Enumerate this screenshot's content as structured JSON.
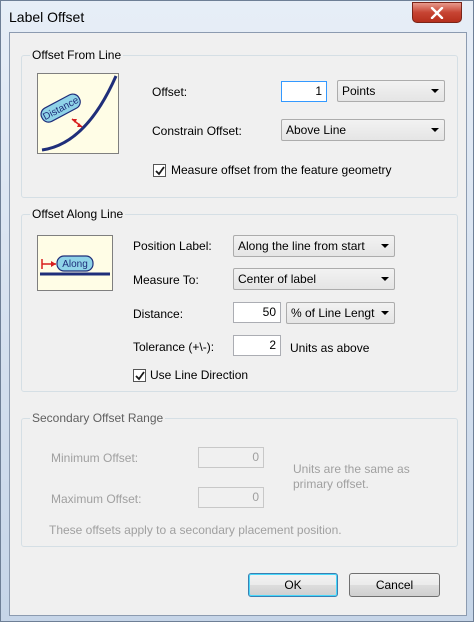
{
  "window": {
    "title": "Label Offset"
  },
  "offset_from_line": {
    "group_title": "Offset From Line",
    "preview_label": "Distance",
    "offset_label": "Offset:",
    "offset_value": "1",
    "offset_units": "Points",
    "constrain_label": "Constrain Offset:",
    "constrain_value": "Above Line",
    "measure_geometry_label": "Measure offset from the feature geometry",
    "measure_geometry_checked": true
  },
  "offset_along_line": {
    "group_title": "Offset Along Line",
    "preview_label": "Along",
    "position_label": "Position Label:",
    "position_value": "Along the line from start",
    "measure_to_label": "Measure To:",
    "measure_to_value": "Center of label",
    "distance_label": "Distance:",
    "distance_value": "50",
    "distance_units": "% of Line Lengt",
    "tolerance_label": "Tolerance (+\\-):",
    "tolerance_value": "2",
    "tolerance_units": "Units as above",
    "use_direction_label": "Use Line Direction",
    "use_direction_checked": true
  },
  "secondary_offset_range": {
    "group_title": "Secondary Offset Range",
    "minimum_label": "Minimum Offset:",
    "minimum_value": "0",
    "maximum_label": "Maximum Offset:",
    "maximum_value": "0",
    "units_note": "Units are the same as primary offset.",
    "footer_note": "These offsets apply to a secondary placement position."
  },
  "buttons": {
    "ok": "OK",
    "cancel": "Cancel"
  },
  "colors": {
    "accent": "#1f2e7a",
    "preview_bg": "#fffde6",
    "pointer_red": "#d81f1f",
    "label_fill": "#8fd3e8"
  }
}
